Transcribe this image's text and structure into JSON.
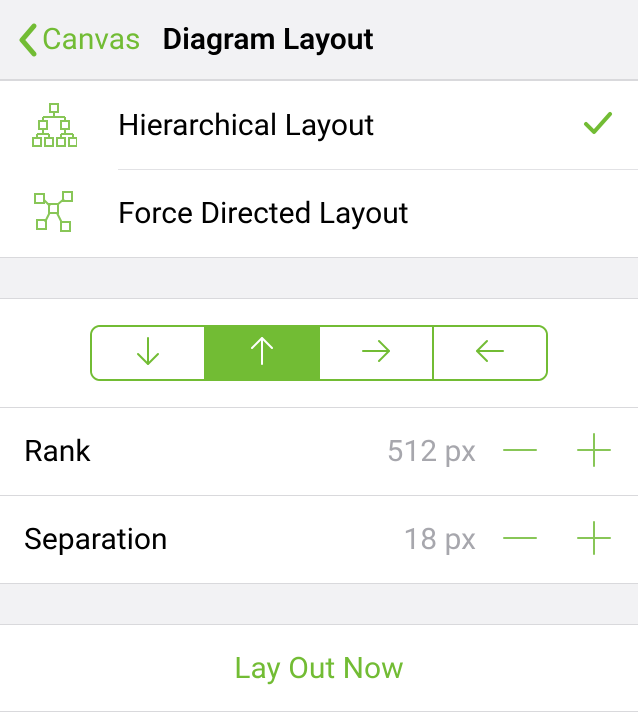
{
  "nav": {
    "back": "Canvas",
    "title": "Diagram Layout"
  },
  "layouts": [
    {
      "label": "Hierarchical Layout",
      "selected": true
    },
    {
      "label": "Force Directed Layout",
      "selected": false
    }
  ],
  "direction": {
    "options": [
      "down",
      "up",
      "right",
      "left"
    ],
    "selected": "up"
  },
  "params": {
    "rank": {
      "label": "Rank",
      "value": "512 px"
    },
    "separation": {
      "label": "Separation",
      "value": "18 px"
    }
  },
  "action": {
    "layOutNow": "Lay Out Now"
  },
  "colors": {
    "accent": "#72bc34"
  }
}
